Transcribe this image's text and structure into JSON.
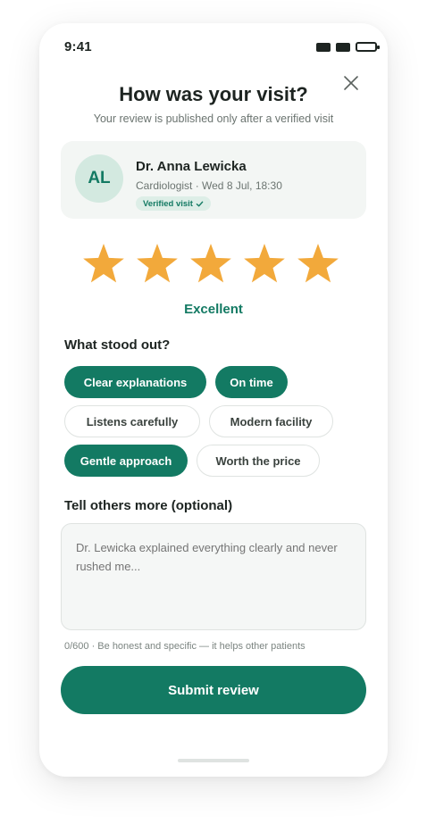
{
  "status_bar": {
    "time": "9:41"
  },
  "header": {
    "title": "How was your visit?",
    "subtitle": "Your review is published only after a verified visit",
    "close_icon": "close-icon"
  },
  "doctor": {
    "initials": "AL",
    "name": "Dr. Anna Lewicka",
    "meta": "Cardiologist · Wed 8 Jul, 18:30",
    "badge": "Verified visit",
    "badge_icon": "check-icon"
  },
  "rating": {
    "value": 5,
    "max": 5,
    "label": "Excellent",
    "star_color": "#f2a93b"
  },
  "highlights": {
    "heading": "What stood out?",
    "chips": [
      {
        "label": "Clear explanations",
        "selected": true
      },
      {
        "label": "On time",
        "selected": true
      },
      {
        "label": "Listens carefully",
        "selected": false
      },
      {
        "label": "Modern facility",
        "selected": false
      },
      {
        "label": "Gentle approach",
        "selected": true
      },
      {
        "label": "Worth the price",
        "selected": false
      }
    ]
  },
  "comment": {
    "heading": "Tell others more (optional)",
    "placeholder": "Dr. Lewicka explained everything clearly and never rushed me...",
    "value": "",
    "helper": "0/600 · Be honest and specific — it helps other patients"
  },
  "submit": {
    "label": "Submit review"
  },
  "colors": {
    "accent": "#137a63",
    "accent_light": "#d3e9e0",
    "star": "#f2a93b"
  }
}
